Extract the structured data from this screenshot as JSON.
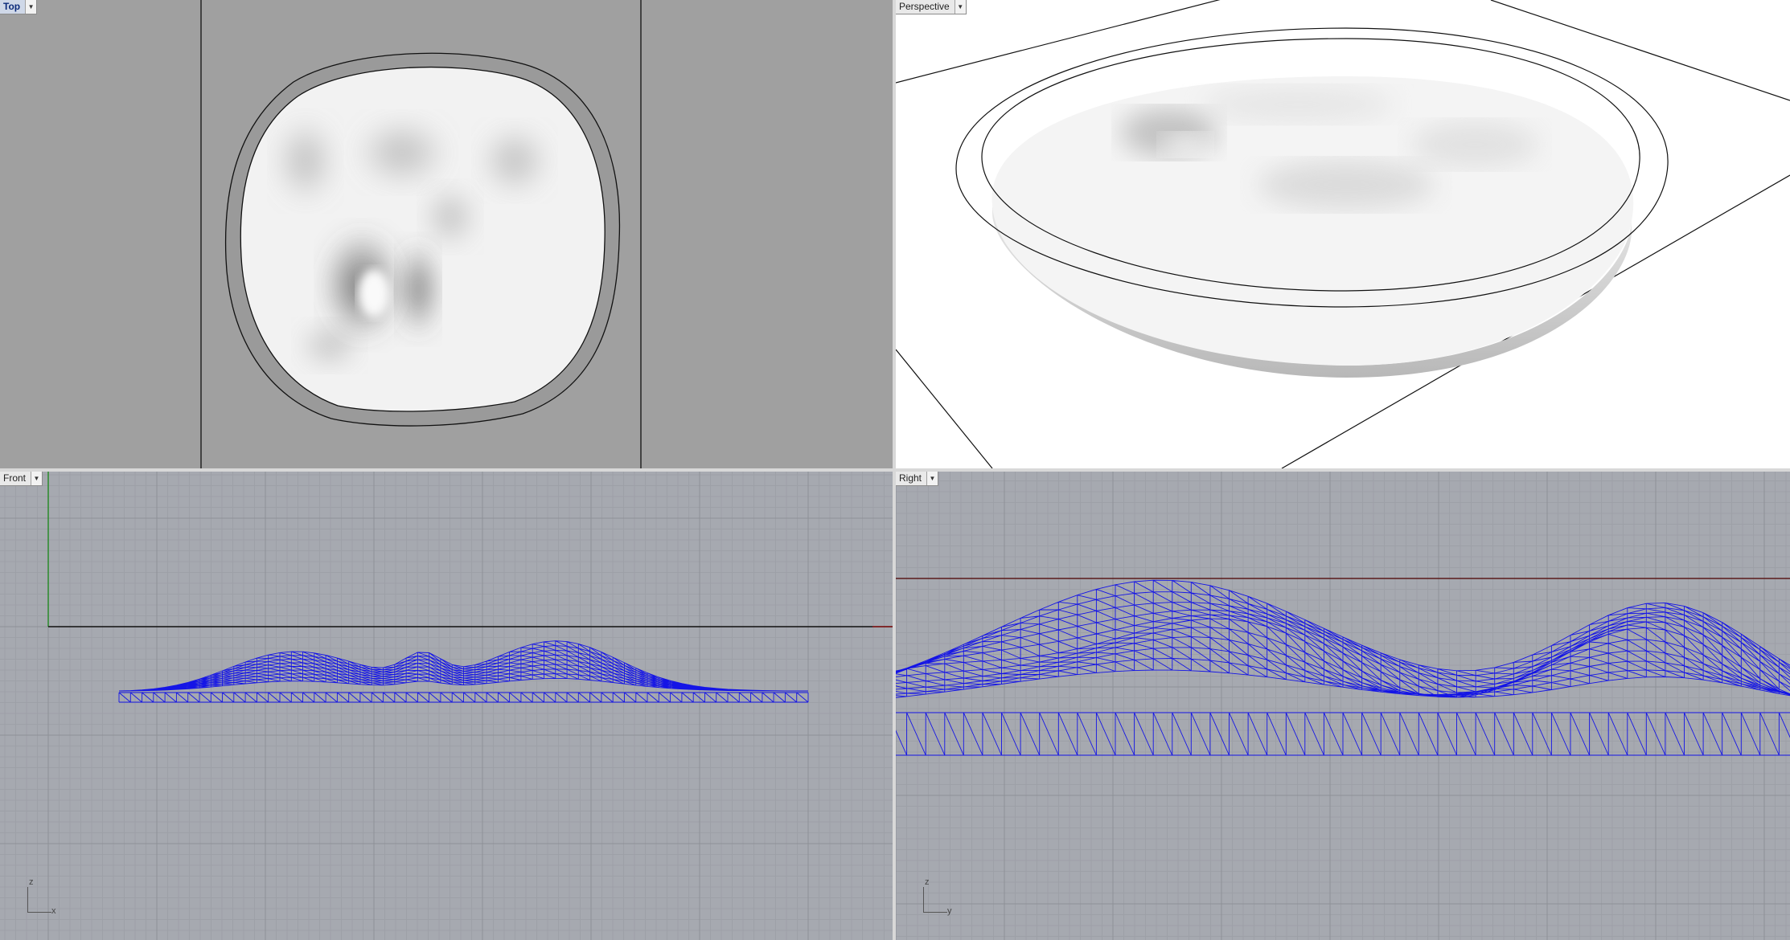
{
  "viewports": {
    "top": {
      "label": "Top",
      "active": true
    },
    "perspective": {
      "label": "Perspective",
      "active": false
    },
    "front": {
      "label": "Front",
      "active": false,
      "axis_v": "z",
      "axis_h": "x"
    },
    "right": {
      "label": "Right",
      "active": false,
      "axis_v": "z",
      "axis_h": "y"
    }
  },
  "icons": {
    "viewport_menu": "chevron-down-icon"
  },
  "colors": {
    "wire": "#1414e6",
    "x_axis": "#8b1a1a",
    "y_axis": "#2a8a2a",
    "grid_minor": "#9da0a7",
    "grid_major": "#8e9197",
    "shaded_bg": "#a0a0a0"
  }
}
